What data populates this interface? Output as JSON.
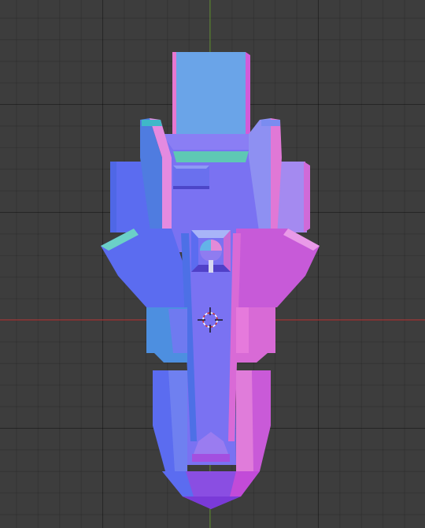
{
  "viewport": {
    "background": "#3d3d3d",
    "grid_line_color": "#2e2e2e",
    "x_axis_color": "#a83a3a",
    "y_axis_color": "#6a9a3a"
  },
  "model": {
    "shading": "normal-map",
    "palette": {
      "blue": "#5b6cf0",
      "periwinkle": "#7a72f2",
      "lavender": "#a48af0",
      "magenta": "#d35bd8",
      "pink": "#e678d0",
      "cyan": "#5fa0e6",
      "teal": "#4ec5a8",
      "purple": "#9a4fe0"
    }
  },
  "cursor": {
    "icon": "3d-cursor-icon"
  }
}
